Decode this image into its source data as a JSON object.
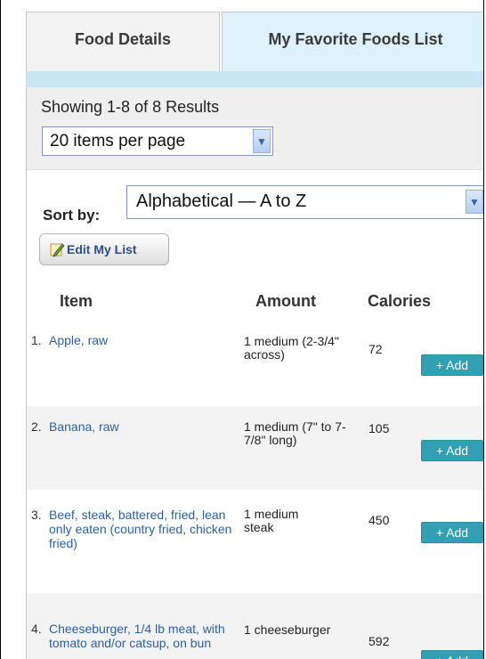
{
  "tabs": [
    {
      "label": "Food Details"
    },
    {
      "label": "My Favorite Foods List"
    }
  ],
  "results": {
    "summary": "Showing 1-8 of 8 Results",
    "per_page": "20 items per page"
  },
  "sort": {
    "label": "Sort by:",
    "value": "Alphabetical — A to Z"
  },
  "edit_button": "Edit My List",
  "columns": {
    "item": "Item",
    "amount": "Amount",
    "calories": "Calories"
  },
  "rows": [
    {
      "num": "1.",
      "item": "Apple, raw",
      "amount": "1 medium (2-3/4\" across)",
      "calories": "72",
      "add": "+ Add"
    },
    {
      "num": "2.",
      "item": "Banana, raw",
      "amount": "1 medium (7\" to 7-7/8\" long)",
      "calories": "105",
      "add": "+ Add"
    },
    {
      "num": "3.",
      "item": "Beef, steak, battered, fried, lean only eaten (country fried, chicken fried)",
      "amount": "1 medium steak",
      "calories": "450",
      "add": "+ Add"
    },
    {
      "num": "4.",
      "item": "Cheeseburger, 1/4 lb meat, with tomato and/or catsup, on bun",
      "amount": "1 cheeseburger",
      "calories": "592",
      "add": "+ Add"
    }
  ],
  "colors": {
    "accent": "#31a0b3",
    "link": "#2f5f9f",
    "tab_active": "#dff1fa"
  }
}
